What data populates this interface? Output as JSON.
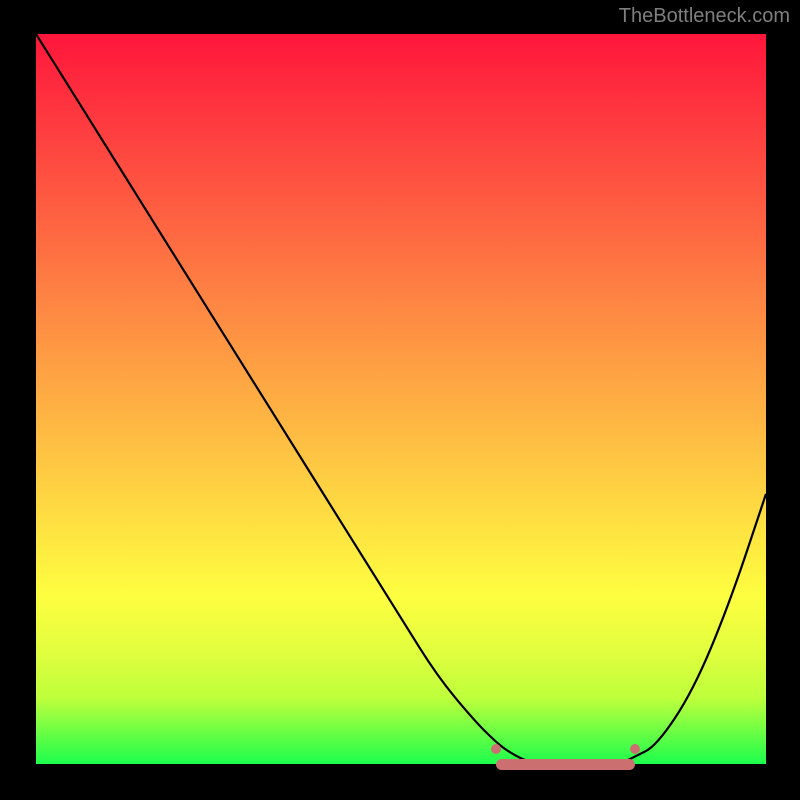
{
  "watermark": "TheBottleneck.com",
  "chart_data": {
    "type": "line",
    "title": "",
    "xlabel": "",
    "ylabel": "",
    "xlim": [
      0,
      100
    ],
    "ylim": [
      0,
      100
    ],
    "x": [
      0,
      5,
      10,
      15,
      20,
      25,
      30,
      35,
      40,
      45,
      50,
      55,
      60,
      63,
      65,
      68,
      72,
      76,
      80,
      82,
      85,
      90,
      95,
      100
    ],
    "y": [
      100,
      92,
      84,
      76,
      68,
      60,
      52,
      44,
      36,
      28,
      20,
      12,
      6,
      3,
      1.5,
      0,
      0,
      0,
      0,
      1,
      2.5,
      10,
      22,
      37
    ],
    "trough_range_x": [
      63,
      82
    ],
    "trough_y": 0,
    "annotations": []
  }
}
